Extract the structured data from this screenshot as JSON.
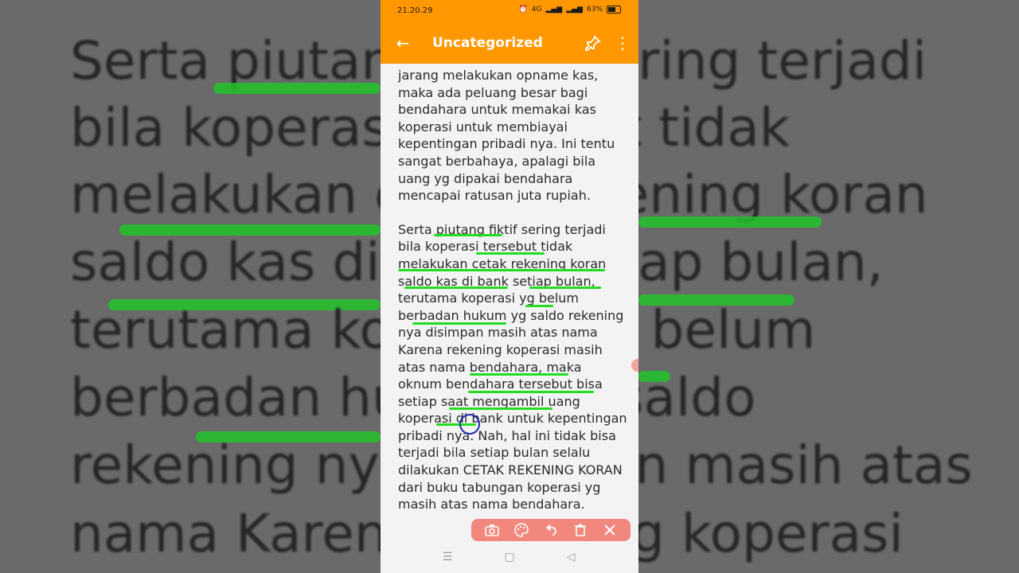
{
  "background": {
    "lines": [
      "Serta piutang fiktif sering terjadi",
      "bila koperasi tersebut tidak",
      "melakukan cetak rekening koran",
      "saldo kas di bank setiap bulan,",
      "terutama koperasi yg belum",
      "berbadan hukum yg saldo",
      "rekening nya disimpan masih atas",
      "nama Karena rekening koperasi"
    ]
  },
  "statusbar": {
    "time": "21.20.29",
    "network": "4G",
    "battery": "63%"
  },
  "appbar": {
    "back_icon": "←",
    "title": "Uncategorized",
    "pin_icon": "pin-icon",
    "more_icon": "⋮"
  },
  "note": {
    "paragraph1": "jarang melakukan opname kas, maka ada peluang besar bagi bendahara untuk memakai kas koperasi untuk membiayai kepentingan pribadi nya. Ini tentu sangat berbahaya, apalagi bila uang yg dipakai bendahara mencapai ratusan juta rupiah.",
    "paragraph2": "Serta piutang fiktif sering terjadi bila koperasi tersebut tidak melakukan cetak rekening koran saldo kas di bank setiap bulan, terutama koperasi yg belum berbadan hukum yg saldo rekening nya disimpan masih atas nama Karena rekening koperasi masih atas nama bendahara, maka oknum bendahara tersebut bisa setiap saat mengambil uang koperasi di bank untuk kepentingan pribadi nya. Nah, hal ini tidak bisa terjadi bila setiap bulan selalu dilakukan CETAK REKENING KORAN dari buku tabungan koperasi yg masih atas nama bendahara."
  },
  "toolbar": {
    "items": [
      "camera-icon",
      "palette-icon",
      "undo-icon",
      "trash-icon",
      "close-icon"
    ]
  },
  "colors": {
    "accent": "#ff9800",
    "highlight": "#22dd22",
    "toolbar": "#f2877e"
  }
}
